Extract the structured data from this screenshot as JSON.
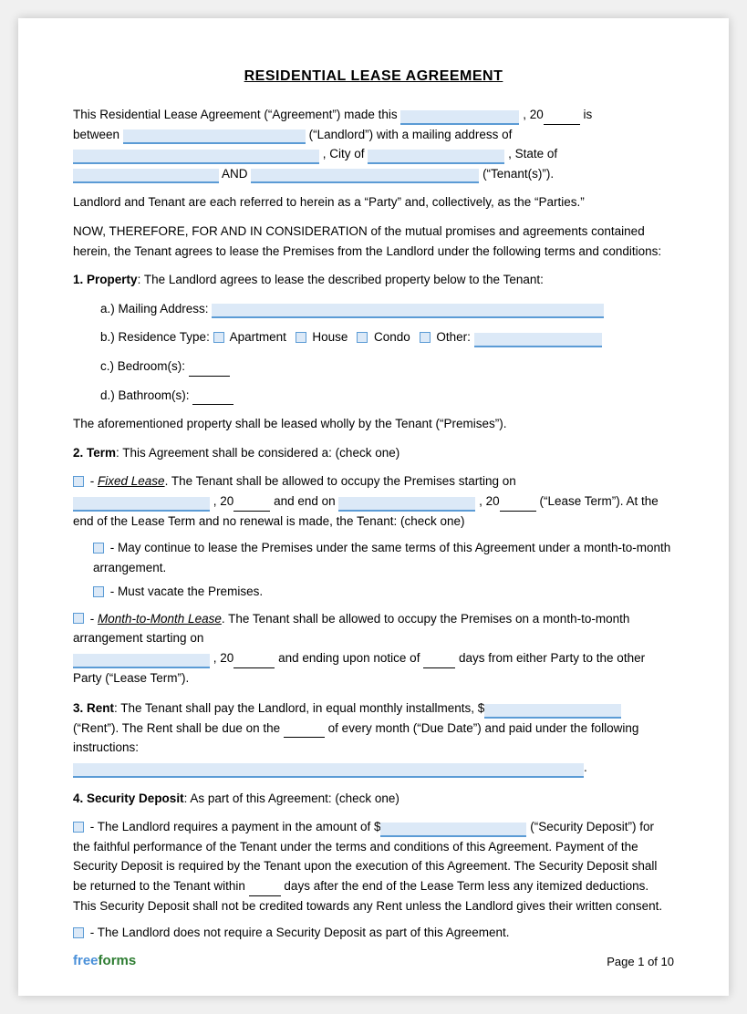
{
  "title": "RESIDENTIAL LEASE AGREEMENT",
  "intro": {
    "line1_pre": "This Residential Lease Agreement (“Agreement”) made this",
    "line1_mid": ", 20",
    "line1_post": "is",
    "line2_pre": "between",
    "line2_mid": "(“Landlord”) with a mailing address of",
    "line3_pre": "",
    "line3_city": ", City of",
    "line3_post": ", State of",
    "line4_and": "AND",
    "line4_post": "(“Tenant(s)”)."
  },
  "parties_text": "Landlord and Tenant are each referred to herein as a “Party” and, collectively, as the “Parties.”",
  "consideration_text": "NOW, THEREFORE, FOR AND IN CONSIDERATION of the mutual promises and agreements contained herein, the Tenant agrees to lease the Premises from the Landlord under the following terms and conditions:",
  "section1": {
    "number": "1.",
    "title": "Property",
    "text": ": The Landlord agrees to lease the described property below to the Tenant:",
    "a_label": "a.)  Mailing Address:",
    "b_label": "b.)  Residence Type:",
    "b_apt": "Apartment",
    "b_house": "House",
    "b_condo": "Condo",
    "b_other": "Other:",
    "c_label": "c.)  Bedroom(s):",
    "d_label": "d.)  Bathroom(s):",
    "closing_text": "The aforementioned property shall be leased wholly by the Tenant (“Premises”)."
  },
  "section2": {
    "number": "2.",
    "title": "Term",
    "text": ": This Agreement shall be considered a: (check one)",
    "fixed_pre": "- ",
    "fixed_label": "Fixed Lease",
    "fixed_text1": ". The Tenant shall be allowed to occupy the Premises starting on",
    "fixed_text2": ", 20",
    "fixed_text3": "and end on",
    "fixed_text4": ", 20",
    "fixed_text5": "(“Lease Term”). At the end of the Lease Term and no renewal is made, the Tenant: (check one)",
    "opt1_text": "- May continue to lease the Premises under the same terms of this Agreement under a month-to-month arrangement.",
    "opt2_text": "- Must vacate the Premises.",
    "month_pre": "- ",
    "month_label": "Month-to-Month Lease",
    "month_text1": ". The Tenant shall be allowed to occupy the Premises on a month-to-month arrangement starting on",
    "month_text2": ", 20",
    "month_text3": "and ending upon notice of",
    "month_text4": "days from either Party to the other Party (“Lease Term”)."
  },
  "section3": {
    "number": "3.",
    "title": "Rent",
    "text1": ": The Tenant shall pay the Landlord, in equal monthly installments, $",
    "text2": "(“Rent”). The Rent shall be due on the",
    "text3": "of every month (“Due Date”) and paid under the following instructions:",
    "dot": "."
  },
  "section4": {
    "number": "4.",
    "title": "Security Deposit",
    "text": ": As part of this Agreement: (check one)",
    "opt1_pre": "- The Landlord requires a payment in the amount of $",
    "opt1_post": "(“Security Deposit”) for the faithful performance of the Tenant under the terms and conditions of this Agreement. Payment of the Security Deposit is required by the Tenant upon the execution of this Agreement. The Security Deposit shall be returned to the Tenant within",
    "opt1_days": "days after the end of the Lease Term less any itemized deductions. This Security Deposit shall not be credited towards any Rent unless the Landlord gives their written consent.",
    "opt2_text": "- The Landlord does not require a Security Deposit as part of this Agreement."
  },
  "footer": {
    "logo_free": "free",
    "logo_forms": "forms",
    "page_text": "Page 1 of 10"
  }
}
